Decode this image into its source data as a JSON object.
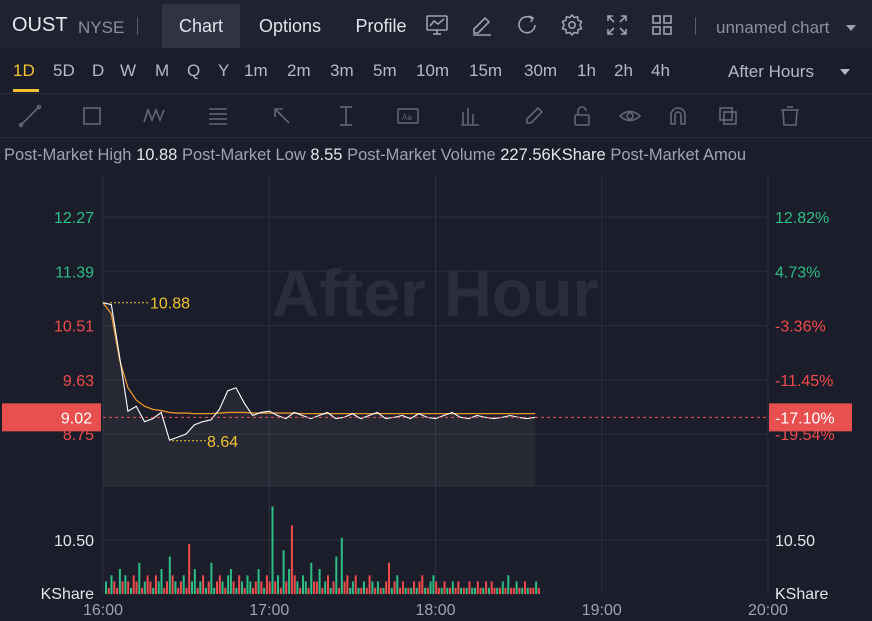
{
  "header": {
    "symbol": "OUST",
    "exchange": "NYSE",
    "tabs": [
      {
        "label": "Chart",
        "active": true
      },
      {
        "label": "Options",
        "active": false
      },
      {
        "label": "Profile",
        "active": false
      }
    ],
    "chart_name": "unnamed chart"
  },
  "periods": {
    "items": [
      "1D",
      "5D",
      "D",
      "W",
      "M",
      "Q",
      "Y",
      "1m",
      "2m",
      "3m",
      "5m",
      "10m",
      "15m",
      "30m",
      "1h",
      "2h",
      "4h"
    ],
    "active": "1D",
    "session": "After Hours"
  },
  "info": {
    "high_label": "Post-Market High",
    "high_value": "10.88",
    "low_label": "Post-Market Low",
    "low_value": "8.55",
    "volume_label": "Post-Market Volume",
    "volume_value": "227.56KShare",
    "amount_label": "Post-Market Amou"
  },
  "colors": {
    "up": "#2ebd85",
    "down": "#f04b4b",
    "price_line": "#ffffff",
    "avg_line": "#e8922e",
    "marker": "#f2c230",
    "current_price_bg": "#e85050"
  },
  "chart_data": {
    "type": "line",
    "watermark": "After Hour",
    "current_price": "9.02",
    "current_percent": "-17.10%",
    "high_marker": "10.88",
    "low_marker": "8.64",
    "price_ticks": [
      {
        "value": 12.27,
        "label": "12.27",
        "percent": "12.82%",
        "dir": "up"
      },
      {
        "value": 11.39,
        "label": "11.39",
        "percent": "4.73%",
        "dir": "up"
      },
      {
        "value": 10.51,
        "label": "10.51",
        "percent": "-3.36%",
        "dir": "down"
      },
      {
        "value": 9.63,
        "label": "9.63",
        "percent": "-11.45%",
        "dir": "down"
      },
      {
        "value": 8.75,
        "label": "8.75",
        "percent": "-19.54%",
        "dir": "down"
      }
    ],
    "volume_tick_label": "10.50",
    "volume_unit": "KShare",
    "x_ticks": [
      "16:00",
      "17:00",
      "18:00",
      "19:00",
      "20:00"
    ],
    "x_minutes": [
      0,
      3,
      6,
      9,
      12,
      15,
      18,
      21,
      24,
      27,
      30,
      33,
      36,
      39,
      42,
      45,
      48,
      51,
      54,
      57,
      60,
      63,
      66,
      69,
      72,
      75,
      78,
      81,
      84,
      87,
      90,
      93,
      96,
      99,
      102,
      105,
      108,
      111,
      114,
      117,
      120,
      123,
      126,
      129,
      132,
      135,
      138,
      141,
      144,
      147,
      150,
      153,
      156
    ],
    "price": [
      10.88,
      10.85,
      10.0,
      9.12,
      9.2,
      8.95,
      9.0,
      9.1,
      8.65,
      8.7,
      8.75,
      8.9,
      8.95,
      8.98,
      9.15,
      9.45,
      9.5,
      9.25,
      9.05,
      9.1,
      9.12,
      9.05,
      9.0,
      9.1,
      9.05,
      9.0,
      9.05,
      9.1,
      9.0,
      9.02,
      9.08,
      9.0,
      9.05,
      9.1,
      9.0,
      9.02,
      9.05,
      9.0,
      9.08,
      9.02,
      9.0,
      9.05,
      9.1,
      9.02,
      9.0,
      9.05,
      9.02,
      9.0,
      9.02,
      9.05,
      9.02,
      9.0,
      9.02
    ],
    "avg": [
      10.88,
      10.7,
      9.95,
      9.5,
      9.3,
      9.2,
      9.15,
      9.13,
      9.1,
      9.09,
      9.09,
      9.08,
      9.08,
      9.08,
      9.09,
      9.1,
      9.1,
      9.1,
      9.09,
      9.09,
      9.09,
      9.09,
      9.09,
      9.09,
      9.08,
      9.08,
      9.08,
      9.08,
      9.08,
      9.08,
      9.08,
      9.08,
      9.08,
      9.08,
      9.08,
      9.08,
      9.08,
      9.08,
      9.08,
      9.08,
      9.08,
      9.08,
      9.08,
      9.08,
      9.08,
      9.08,
      9.08,
      9.08,
      9.08,
      9.08,
      9.08,
      9.08,
      9.08
    ],
    "volume": [
      2,
      1,
      3,
      2,
      1,
      4,
      2,
      3,
      2,
      1,
      3,
      2,
      5,
      1,
      2,
      3,
      2,
      1,
      3,
      2,
      4,
      1,
      2,
      6,
      3,
      2,
      1,
      2,
      3,
      1,
      8,
      2,
      4,
      1,
      2,
      3,
      1,
      2,
      5,
      1,
      2,
      3,
      2,
      1,
      3,
      4,
      2,
      1,
      3,
      2,
      1,
      3,
      2,
      1,
      2,
      4,
      2,
      1,
      3,
      2,
      14,
      2,
      3,
      1,
      7,
      2,
      4,
      11,
      3,
      2,
      1,
      3,
      2,
      1,
      5,
      2,
      2,
      4,
      1,
      2,
      3,
      1,
      2,
      6,
      1,
      9,
      2,
      3,
      1,
      2,
      3,
      1,
      1,
      2,
      1,
      3,
      2,
      1,
      2,
      1,
      1,
      2,
      5,
      1,
      2,
      3,
      1,
      2,
      1,
      1,
      1,
      2,
      1,
      2,
      3,
      1,
      1,
      2,
      3,
      2,
      1,
      1,
      2,
      1,
      1,
      2,
      1,
      2,
      1,
      1,
      1,
      2,
      1,
      1,
      2,
      1,
      1,
      2,
      1,
      2,
      1,
      1,
      1,
      2,
      1,
      3,
      1,
      1,
      2,
      1,
      1,
      2,
      1,
      1,
      1,
      2,
      1
    ],
    "volume_dir": [
      1,
      0,
      1,
      0,
      0,
      1,
      0,
      1,
      0,
      1,
      0,
      0,
      1,
      0,
      1,
      0,
      0,
      1,
      0,
      1,
      1,
      0,
      0,
      1,
      0,
      1,
      0,
      0,
      1,
      0,
      0,
      1,
      1,
      0,
      1,
      0,
      1,
      0,
      1,
      1,
      0,
      0,
      1,
      0,
      1,
      1,
      0,
      1,
      0,
      1,
      0,
      1,
      1,
      0,
      0,
      1,
      0,
      1,
      0,
      0,
      1,
      0,
      1,
      0,
      1,
      0,
      1,
      0,
      0,
      1,
      0,
      1,
      1,
      0,
      1,
      0,
      0,
      1,
      0,
      1,
      0,
      1,
      0,
      1,
      0,
      1,
      0,
      0,
      1,
      1,
      0,
      1,
      0,
      1,
      0,
      0,
      1,
      0,
      1,
      0,
      1,
      0,
      0,
      1,
      0,
      1,
      0,
      0,
      1,
      0,
      1,
      0,
      1,
      0,
      0,
      1,
      0,
      1,
      1,
      0,
      0,
      1,
      0,
      1,
      0,
      1,
      0,
      0,
      1,
      0,
      1,
      0,
      1,
      1,
      0,
      0,
      1,
      0,
      1,
      0,
      0,
      1,
      0,
      1,
      0,
      1,
      0,
      0,
      1,
      0,
      1,
      0,
      1,
      0,
      0,
      1,
      0
    ]
  }
}
